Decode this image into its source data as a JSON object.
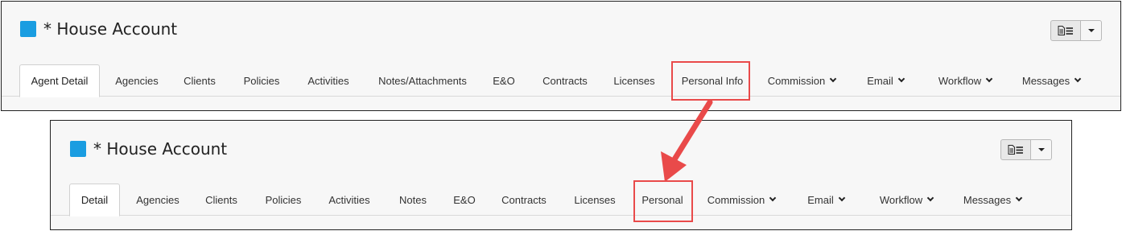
{
  "top_panel": {
    "title": "* House Account",
    "tabs": [
      {
        "label": "Agent Detail",
        "active": true,
        "dropdown": false
      },
      {
        "label": "Agencies",
        "active": false,
        "dropdown": false
      },
      {
        "label": "Clients",
        "active": false,
        "dropdown": false
      },
      {
        "label": "Policies",
        "active": false,
        "dropdown": false
      },
      {
        "label": "Activities",
        "active": false,
        "dropdown": false
      },
      {
        "label": "Notes/Attachments",
        "active": false,
        "dropdown": false
      },
      {
        "label": "E&O",
        "active": false,
        "dropdown": false
      },
      {
        "label": "Contracts",
        "active": false,
        "dropdown": false
      },
      {
        "label": "Licenses",
        "active": false,
        "dropdown": false
      },
      {
        "label": "Personal Info",
        "active": false,
        "dropdown": false
      },
      {
        "label": "Commission",
        "active": false,
        "dropdown": true
      },
      {
        "label": "Email",
        "active": false,
        "dropdown": true
      },
      {
        "label": "Workflow",
        "active": false,
        "dropdown": true
      },
      {
        "label": "Messages",
        "active": false,
        "dropdown": true
      }
    ]
  },
  "bottom_panel": {
    "title": "* House Account",
    "tabs": [
      {
        "label": "Detail",
        "active": true,
        "dropdown": false
      },
      {
        "label": "Agencies",
        "active": false,
        "dropdown": false
      },
      {
        "label": "Clients",
        "active": false,
        "dropdown": false
      },
      {
        "label": "Policies",
        "active": false,
        "dropdown": false
      },
      {
        "label": "Activities",
        "active": false,
        "dropdown": false
      },
      {
        "label": "Notes",
        "active": false,
        "dropdown": false
      },
      {
        "label": "E&O",
        "active": false,
        "dropdown": false
      },
      {
        "label": "Contracts",
        "active": false,
        "dropdown": false
      },
      {
        "label": "Licenses",
        "active": false,
        "dropdown": false
      },
      {
        "label": "Personal",
        "active": false,
        "dropdown": false
      },
      {
        "label": "Commission",
        "active": false,
        "dropdown": true
      },
      {
        "label": "Email",
        "active": false,
        "dropdown": true
      },
      {
        "label": "Workflow",
        "active": false,
        "dropdown": true
      },
      {
        "label": "Messages",
        "active": false,
        "dropdown": true
      }
    ]
  },
  "icons": {
    "record_color": "#1a9de1",
    "report_button": "document-list-icon",
    "menu_caret": "caret-down-icon"
  },
  "annotation": {
    "highlight_color": "#e94a4a",
    "highlighted_tab_top": "Personal Info",
    "highlighted_tab_bottom": "Personal"
  }
}
